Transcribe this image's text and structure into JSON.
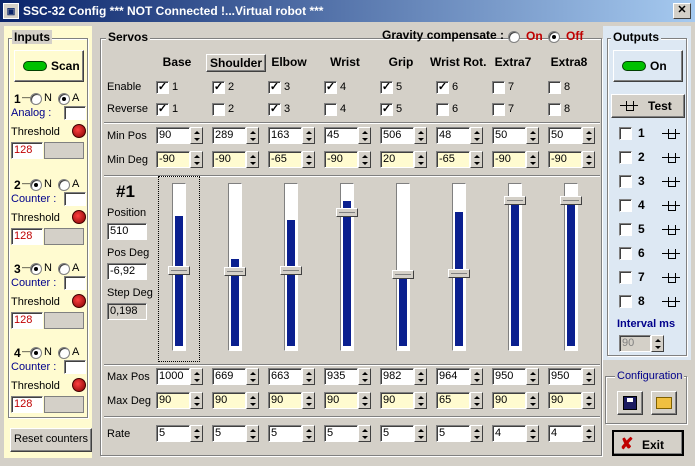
{
  "window": {
    "title": "SSC-32 Config  *** NOT Connected !...Virtual robot ***",
    "close": "✕"
  },
  "inputs": {
    "label": "Inputs",
    "scan": "Scan",
    "blocks": [
      {
        "num": "1",
        "radio_n": "N",
        "radio_a": "A",
        "selected": "A",
        "mode": "Analog :",
        "threshold": "Threshold",
        "value": "128"
      },
      {
        "num": "2",
        "radio_n": "N",
        "radio_a": "A",
        "selected": "N",
        "mode": "Counter :",
        "threshold": "Threshold",
        "value": "128"
      },
      {
        "num": "3",
        "radio_n": "N",
        "radio_a": "A",
        "selected": "N",
        "mode": "Counter :",
        "threshold": "Threshold",
        "value": "128"
      },
      {
        "num": "4",
        "radio_n": "N",
        "radio_a": "A",
        "selected": "N",
        "mode": "Counter :",
        "threshold": "Threshold",
        "value": "128"
      }
    ],
    "reset": "Reset counters"
  },
  "servos": {
    "label": "Servos",
    "gravity": {
      "label": "Gravity compensate :",
      "on": "On",
      "off": "Off",
      "selected": "Off"
    },
    "row_labels": {
      "enable": "Enable",
      "reverse": "Reverse",
      "minpos": "Min Pos",
      "mindeg": "Min Deg",
      "maxpos": "Max Pos",
      "maxdeg": "Max Deg",
      "rate": "Rate"
    },
    "info": {
      "id": "#1",
      "position_label": "Position",
      "position": "510",
      "posdeg_label": "Pos Deg",
      "posdeg": "-6,92",
      "stepdeg_label": "Step Deg",
      "stepdeg": "0,198"
    },
    "columns": [
      {
        "name": "Base",
        "enable": true,
        "en_num": "1",
        "reverse": true,
        "rev_num": "1",
        "minpos": "90",
        "mindeg": "-90",
        "maxpos": "1000",
        "maxdeg": "90",
        "rate": "5",
        "level": 0.82,
        "thumb": 0.48
      },
      {
        "name": "Shoulder",
        "enable": true,
        "en_num": "2",
        "reverse": false,
        "rev_num": "2",
        "minpos": "289",
        "mindeg": "-90",
        "maxpos": "669",
        "maxdeg": "90",
        "rate": "5",
        "level": 0.55,
        "thumb": 0.47
      },
      {
        "name": "Elbow",
        "enable": true,
        "en_num": "3",
        "reverse": true,
        "rev_num": "3",
        "minpos": "163",
        "mindeg": "-65",
        "maxpos": "663",
        "maxdeg": "90",
        "rate": "5",
        "level": 0.8,
        "thumb": 0.48
      },
      {
        "name": "Wrist",
        "enable": true,
        "en_num": "4",
        "reverse": false,
        "rev_num": "4",
        "minpos": "45",
        "mindeg": "-90",
        "maxpos": "935",
        "maxdeg": "90",
        "rate": "5",
        "level": 0.92,
        "thumb": 0.84
      },
      {
        "name": "Grip",
        "enable": true,
        "en_num": "5",
        "reverse": true,
        "rev_num": "5",
        "minpos": "506",
        "mindeg": "20",
        "maxpos": "982",
        "maxdeg": "90",
        "rate": "5",
        "level": 0.45,
        "thumb": 0.45
      },
      {
        "name": "Wrist Rot.",
        "enable": true,
        "en_num": "6",
        "reverse": false,
        "rev_num": "6",
        "minpos": "48",
        "mindeg": "-65",
        "maxpos": "964",
        "maxdeg": "65",
        "rate": "5",
        "level": 0.85,
        "thumb": 0.46
      },
      {
        "name": "Extra7",
        "enable": false,
        "en_num": "7",
        "reverse": false,
        "rev_num": "7",
        "minpos": "50",
        "mindeg": "-90",
        "maxpos": "950",
        "maxdeg": "90",
        "rate": "4",
        "level": 0.92,
        "thumb": 0.92
      },
      {
        "name": "Extra8",
        "enable": false,
        "en_num": "8",
        "reverse": false,
        "rev_num": "8",
        "minpos": "50",
        "mindeg": "-90",
        "maxpos": "950",
        "maxdeg": "90",
        "rate": "4",
        "level": 0.92,
        "thumb": 0.92
      }
    ]
  },
  "outputs": {
    "label": "Outputs",
    "on": "On",
    "test": "Test",
    "items": [
      "1",
      "2",
      "3",
      "4",
      "5",
      "6",
      "7",
      "8"
    ],
    "interval_label": "Interval ms",
    "interval": "90"
  },
  "config": {
    "label": "Configuration"
  },
  "exit": "Exit",
  "colors": {
    "accent": "#0a1f8f",
    "panel": "#fffbd0",
    "title": "#0a246a"
  }
}
